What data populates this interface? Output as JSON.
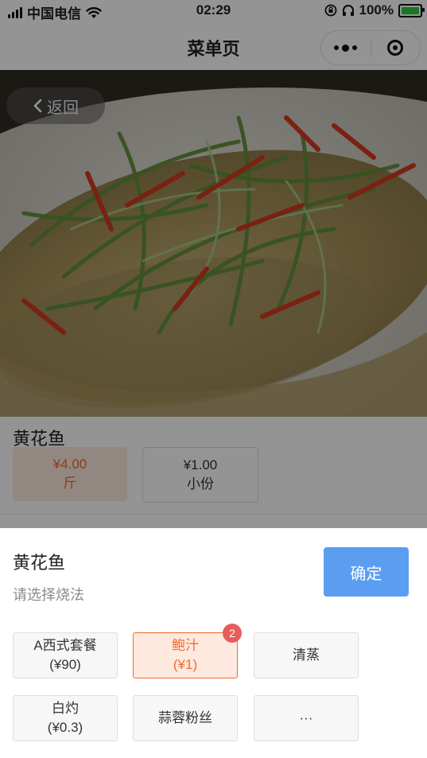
{
  "status_bar": {
    "carrier": "中国电信",
    "time": "02:29",
    "battery": "100%"
  },
  "nav": {
    "title": "菜单页"
  },
  "hero": {
    "back_label": "返回"
  },
  "dish": {
    "name": "黄花鱼",
    "specs": [
      {
        "price": "¥4.00",
        "unit": "斤"
      },
      {
        "price": "¥1.00",
        "unit": "小份"
      }
    ]
  },
  "sheet": {
    "title": "黄花鱼",
    "subtitle": "请选择烧法",
    "confirm_label": "确定",
    "options": [
      {
        "name": "A西式套餐",
        "price": "(¥90)"
      },
      {
        "name": "鲍汁",
        "price": "(¥1)",
        "badge": "2"
      },
      {
        "name": "清蒸"
      },
      {
        "name": "白灼",
        "price": "(¥0.3)"
      },
      {
        "name": "蒜蓉粉丝"
      },
      {
        "name": "···"
      }
    ]
  },
  "colors": {
    "accent_orange": "#f06b2c",
    "confirm_blue": "#5b9ef1",
    "badge_red": "#e85c5c"
  }
}
